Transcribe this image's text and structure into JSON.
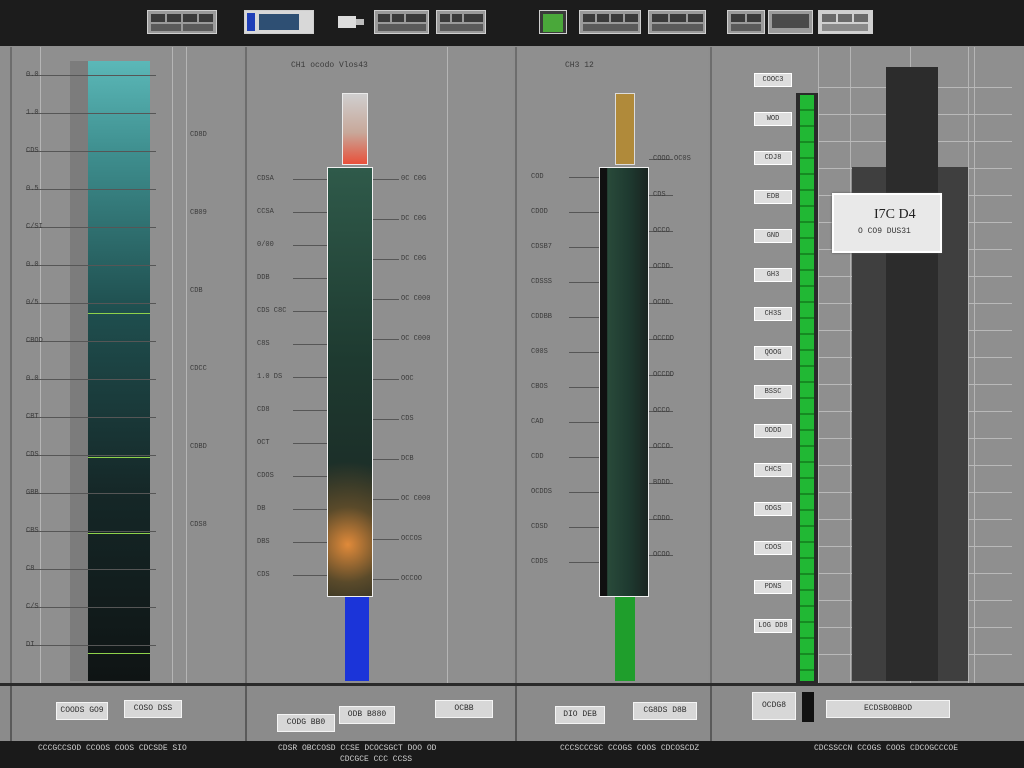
{
  "toolbar": {
    "thumbnails": [
      "layout-thumb",
      "display-thumb",
      "camera-thumb",
      "grid-thumb",
      "grid-thumb",
      "green-thumb",
      "grid-thumb",
      "grid-thumb",
      "grid-thumb",
      "grid-thumb",
      "grid-thumb"
    ]
  },
  "panels": {
    "p2_title": "CH1 ocodo   Vlos43",
    "p3_title": "CH3 12",
    "p4_callout_title": "I7C D4",
    "p4_callout_sub": "O CO9 DUS31",
    "p4_labels": [
      "COOC3",
      "WOD",
      "CDJ8",
      "EDB",
      "GND",
      "GH3",
      "CH3S",
      "QOOG",
      "BSSC",
      "ODDD",
      "CHCS",
      "ODGS",
      "CDOS",
      "PDNS",
      "LOG DD8"
    ],
    "p1_left_labels": [
      "0.0",
      "1.0",
      "CDS",
      "0.5",
      "C/SI",
      "0.0",
      "0/5",
      "CBOD",
      "0.0",
      "CBT",
      "CDS",
      "GBB",
      "CBS",
      "C8",
      "C/S",
      "DI"
    ],
    "p1_right_labels": [
      "CD8D",
      "CB09",
      "CDB",
      "CDCC",
      "CDBD",
      "CDS8"
    ],
    "p2_left_labels": [
      "CDSA",
      "CCSA",
      "0/00",
      "DDB",
      "CDS C8C",
      "C8S",
      "1.0 DS",
      "CD8",
      "OCT",
      "CDOS",
      "DB",
      "DBS",
      "CDS"
    ],
    "p2_right_labels": [
      "0C C0G",
      "DC C0G",
      "DC C0G",
      "OC C000",
      "OC C000",
      "OOC",
      "CDS",
      "DCB",
      "OC C000",
      "OCCOS",
      "OCCOO"
    ],
    "p3_left_labels": [
      "COD",
      "CDOD",
      "CDSB7",
      "CDSSS",
      "CDDBB",
      "C00S",
      "CBOS",
      "CAD",
      "CDD",
      "OCDDS",
      "CDSD",
      "CDDS"
    ],
    "p3_right_labels": [
      "COOO OC0S",
      "CDS",
      "OCCO",
      "OCDD",
      "OCDD",
      "OCCDD",
      "OCCDD",
      "OCCO",
      "OCCO",
      "BDDD",
      "CDDO",
      "OCOO"
    ]
  },
  "bottom": {
    "chips": [
      "COODS GO9",
      "COSO DSS",
      "CODG BB0",
      "ODB B880",
      "OCBB",
      "DIO DEB",
      "CG8DS D8B",
      "OCDG8",
      "ECDSBOBBOD"
    ],
    "footer": [
      {
        "line1": "CCCGCCSOD CCOOS COOS CDCSDE SIO",
        "line2": ""
      },
      {
        "line1": "CDSR OBCCOSD CCSE DCOCSGCT DOO OD",
        "line2": "CDCGCE CCC CCSS"
      },
      {
        "line1": "CCCSCCCSC CCOGS COOS CDCOSCDZ",
        "line2": ""
      },
      {
        "line1": "CDCSSCCN CCOGS COOS CDCOGCCCOE",
        "line2": ""
      }
    ]
  },
  "colors": {
    "teal_top": "#5bb8b8",
    "red_accent": "#e8503a",
    "blue_accent": "#1b34d9",
    "gold_accent": "#b08a3a",
    "green_accent": "#1f9e2c",
    "bright_green": "#3ed23a"
  }
}
